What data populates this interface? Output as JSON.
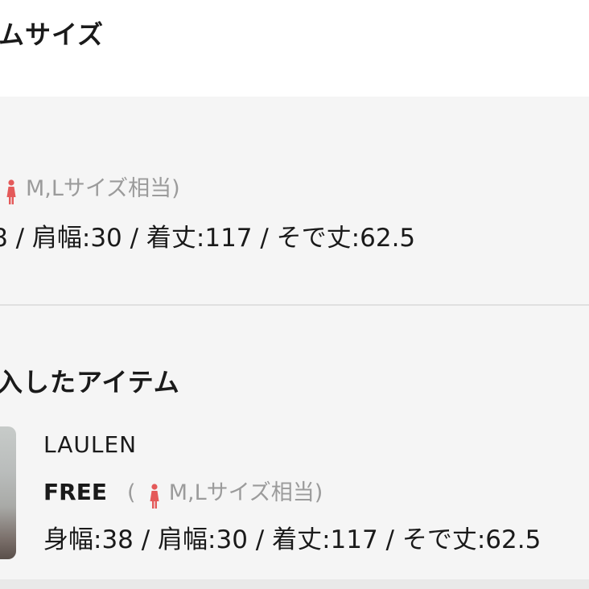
{
  "header": {
    "title": "ムサイズ"
  },
  "current_item": {
    "size_note": "M,Lサイズ相当)",
    "measurements": "8 / 肩幅:30 / 着丈:117 / そで丈:62.5"
  },
  "purchased_section": {
    "title": "入したアイテム",
    "item": {
      "brand": "LAULEN",
      "size": "FREE",
      "size_note_open": "(",
      "size_note": "M,Lサイズ相当)",
      "measurements": "身幅:38 / 肩幅:30 / 着丈:117 / そで丈:62.5"
    }
  },
  "colors": {
    "icon_red": "#e45a5a",
    "muted_text": "#9b9b9b",
    "panel_bg": "#f5f5f5"
  }
}
